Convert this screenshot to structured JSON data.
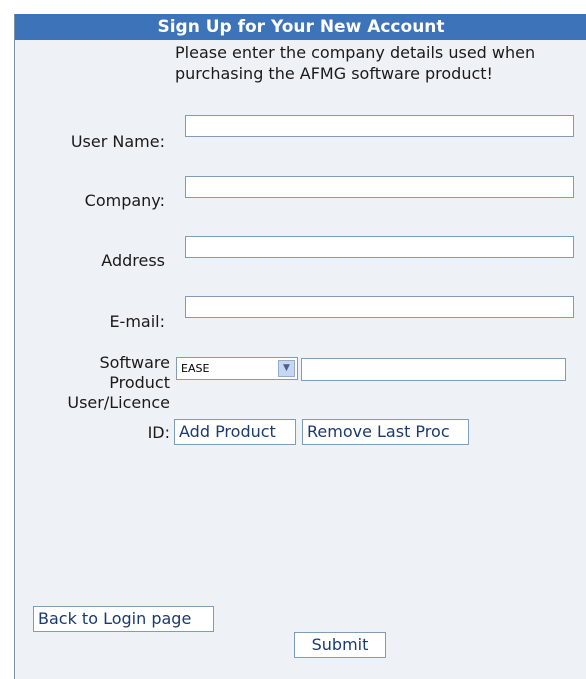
{
  "form": {
    "title": "Sign Up for Your New Account",
    "intro": "Please enter the company details used when purchasing the AFMG software product!",
    "fields": {
      "username_label": "User Name:",
      "company_label": "Company:",
      "address_label": "Address",
      "email_label": "E-mail:",
      "username_value": "",
      "company_value": "",
      "address_value": "",
      "email_value": ""
    },
    "product": {
      "label_line1": "Software",
      "label_line2": "Product",
      "label_line3": "User/Licence",
      "label_line4": "ID:",
      "selected": "EASE",
      "licence_value": ""
    },
    "buttons": {
      "add_product": "Add Product",
      "remove_last": "Remove Last Proc",
      "back_to_login": "Back to Login page",
      "submit": "Submit"
    }
  }
}
